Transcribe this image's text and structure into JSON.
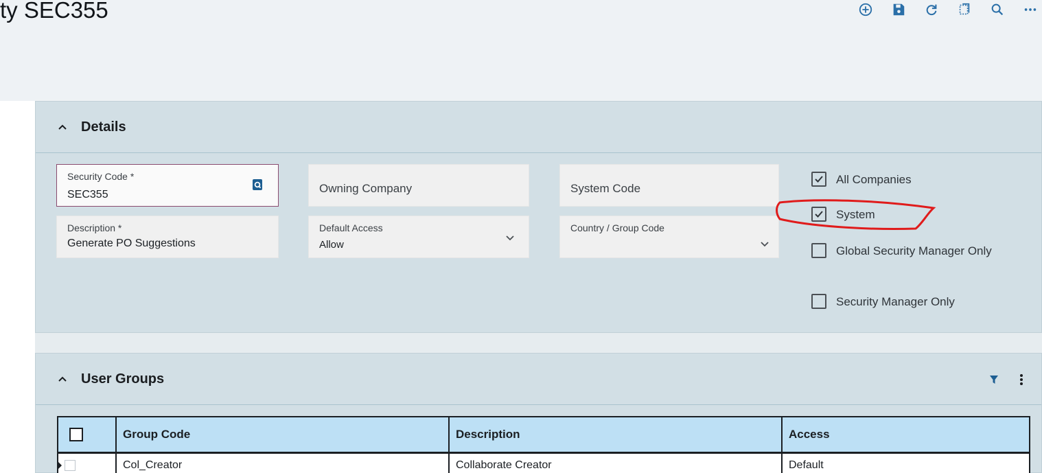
{
  "header": {
    "title": "ty SEC355"
  },
  "toolbar": [
    "add-icon",
    "save-icon",
    "refresh-icon",
    "copy-icon",
    "search-icon",
    "more-icon"
  ],
  "colors": {
    "accent": "#2a6fa8",
    "panel": "#d2dfe5",
    "grid_header": "#bde0f5",
    "annotation": "#e01b1b"
  },
  "details": {
    "title": "Details",
    "security_code": {
      "label": "Security Code *",
      "value": "SEC355"
    },
    "owning_company": {
      "placeholder": "Owning Company"
    },
    "system_code": {
      "placeholder": "System Code"
    },
    "description": {
      "label": "Description *",
      "value": "Generate PO Suggestions"
    },
    "default_access": {
      "label": "Default Access",
      "value": "Allow"
    },
    "country_group": {
      "label": "Country / Group Code"
    },
    "checkboxes": [
      {
        "label": "All Companies",
        "checked": true
      },
      {
        "label": "System",
        "checked": true
      },
      {
        "label": "Global Security Manager Only",
        "checked": false
      },
      {
        "label": "Security Manager Only",
        "checked": false
      }
    ]
  },
  "user_groups": {
    "title": "User Groups",
    "columns": [
      "Group Code",
      "Description",
      "Access"
    ],
    "rows": [
      {
        "group_code": "Col_Creator",
        "description": "Collaborate Creator",
        "access": "Default"
      }
    ]
  }
}
